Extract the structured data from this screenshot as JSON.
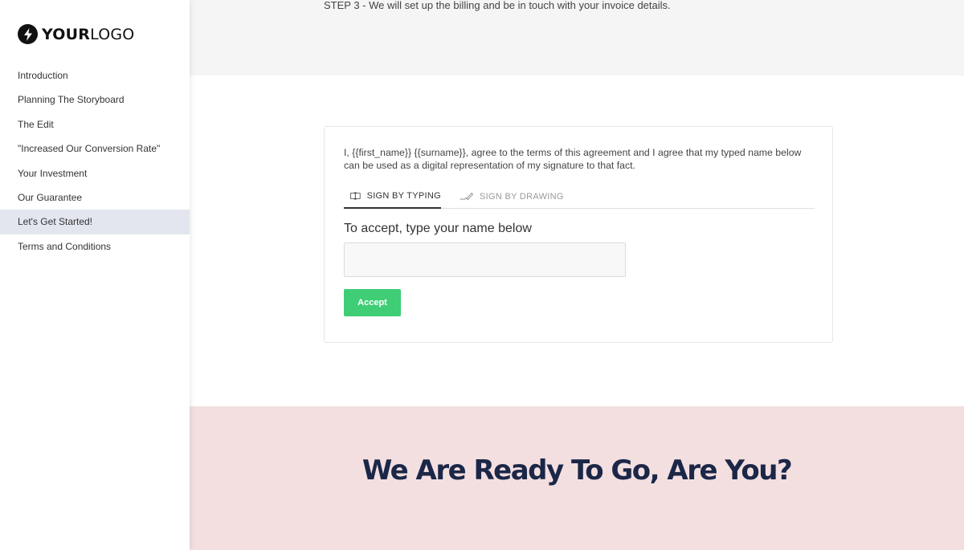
{
  "logo": {
    "bold_part": "YOUR",
    "light_part": "LOGO",
    "icon": "lightning-bolt-icon"
  },
  "sidebar": {
    "items": [
      {
        "label": "Introduction",
        "active": false
      },
      {
        "label": "Planning The Storyboard",
        "active": false
      },
      {
        "label": "The Edit",
        "active": false
      },
      {
        "label": "\"Increased Our Conversion Rate\"",
        "active": false
      },
      {
        "label": "Your Investment",
        "active": false
      },
      {
        "label": "Our Guarantee",
        "active": false
      },
      {
        "label": "Let's Get Started!",
        "active": true
      },
      {
        "label": "Terms and Conditions",
        "active": false
      }
    ]
  },
  "main": {
    "step_text": "STEP 3 - We will set up the billing and be in touch with your invoice details.",
    "agreement": {
      "text": "I, {{first_name}} {{surname}}, agree to the terms of this agreement and I agree that my typed name below can be used as a digital representation of my signature to that fact.",
      "tabs": [
        {
          "label": "SIGN BY TYPING",
          "icon": "text-cursor-icon",
          "active": true
        },
        {
          "label": "SIGN BY DRAWING",
          "icon": "signature-pen-icon",
          "active": false
        }
      ],
      "accept_label": "To accept, type your name below",
      "name_input": {
        "value": "",
        "placeholder": ""
      },
      "accept_button": "Accept"
    },
    "cta_heading": "We Are Ready To Go, Are You?"
  },
  "colors": {
    "accent_green": "#3fce76",
    "active_nav_bg": "#e3e6ee",
    "pink_band": "#f3dfe0",
    "heading_navy": "#1b2747",
    "top_band": "#f5f5f5"
  }
}
